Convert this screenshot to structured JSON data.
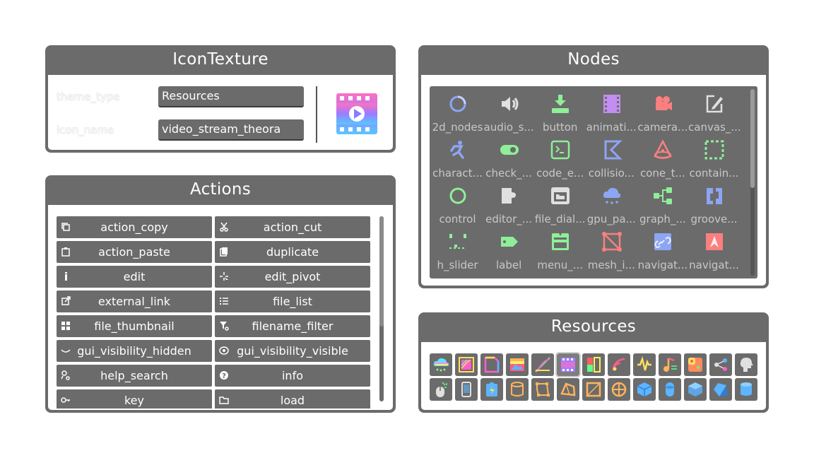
{
  "icontexture": {
    "title": "IconTexture",
    "theme_type_label": "theme_type",
    "theme_type_value": "Resources",
    "icon_name_label": "icon_name",
    "icon_name_value": "video_stream_theora"
  },
  "actions": {
    "title": "Actions",
    "items": [
      {
        "label": "action_copy",
        "icon": "copy-icon"
      },
      {
        "label": "action_cut",
        "icon": "scissors-icon"
      },
      {
        "label": "action_paste",
        "icon": "paste-icon"
      },
      {
        "label": "duplicate",
        "icon": "duplicate-icon"
      },
      {
        "label": "edit",
        "icon": "pencil-icon"
      },
      {
        "label": "edit_pivot",
        "icon": "pivot-icon"
      },
      {
        "label": "external_link",
        "icon": "external-link-icon"
      },
      {
        "label": "file_list",
        "icon": "list-icon"
      },
      {
        "label": "file_thumbnail",
        "icon": "thumbnail-grid-icon"
      },
      {
        "label": "filename_filter",
        "icon": "filter-icon"
      },
      {
        "label": "gui_visibility_hidden",
        "icon": "eye-closed-icon"
      },
      {
        "label": "gui_visibility_visible",
        "icon": "eye-open-icon"
      },
      {
        "label": "help_search",
        "icon": "help-search-icon"
      },
      {
        "label": "info",
        "icon": "info-icon"
      },
      {
        "label": "key",
        "icon": "key-icon"
      },
      {
        "label": "load",
        "icon": "folder-icon"
      }
    ]
  },
  "nodes": {
    "title": "Nodes",
    "items": [
      {
        "label": "2d_nodes",
        "icon": "ring-icon",
        "color": "#8da5f3"
      },
      {
        "label": "audio_s...",
        "icon": "speaker-icon",
        "color": "#e0e0e0"
      },
      {
        "label": "button",
        "icon": "download-button-icon",
        "color": "#8eef97"
      },
      {
        "label": "animati...",
        "icon": "film-icon",
        "color": "#c38ef1"
      },
      {
        "label": "camera...",
        "icon": "camera-icon",
        "color": "#fc7f7f"
      },
      {
        "label": "canvas_...",
        "icon": "canvas-edit-icon",
        "color": "#e0e0e0"
      },
      {
        "label": "charact...",
        "icon": "character-icon",
        "color": "#8da5f3"
      },
      {
        "label": "check_...",
        "icon": "toggle-icon",
        "color": "#8eef97"
      },
      {
        "label": "code_e...",
        "icon": "terminal-icon",
        "color": "#8eef97"
      },
      {
        "label": "collisio...",
        "icon": "collision-icon",
        "color": "#8da5f3"
      },
      {
        "label": "cone_t...",
        "icon": "cone-icon",
        "color": "#fc7f7f"
      },
      {
        "label": "contain...",
        "icon": "container-icon",
        "color": "#8eef97"
      },
      {
        "label": "control",
        "icon": "control-ring-icon",
        "color": "#8eef97"
      },
      {
        "label": "editor_...",
        "icon": "plugin-icon",
        "color": "#e0e0e0"
      },
      {
        "label": "file_dial...",
        "icon": "file-dialog-icon",
        "color": "#e0e0e0"
      },
      {
        "label": "gpu_pa...",
        "icon": "cloud-particles-icon",
        "color": "#8da5f3"
      },
      {
        "label": "graph_...",
        "icon": "graph-icon",
        "color": "#8eef97"
      },
      {
        "label": "groove...",
        "icon": "groove-joint-icon",
        "color": "#8da5f3"
      },
      {
        "label": "h_slider",
        "icon": "slider-icon",
        "color": "#8eef97"
      },
      {
        "label": "label",
        "icon": "tag-icon",
        "color": "#8eef97"
      },
      {
        "label": "menu_...",
        "icon": "menu-bar-icon",
        "color": "#8eef97"
      },
      {
        "label": "mesh_i...",
        "icon": "mesh-icon",
        "color": "#fc7f7f"
      },
      {
        "label": "navigat...",
        "icon": "navigation-link-icon",
        "color": "#8da5f3"
      },
      {
        "label": "navigat...",
        "icon": "navigation-region-icon",
        "color": "#fc7f7f"
      }
    ]
  },
  "resources": {
    "title": "Resources",
    "items": [
      {
        "icon": "rainbow-cloud-icon",
        "selected": false
      },
      {
        "icon": "gradient-texture-icon",
        "selected": false
      },
      {
        "icon": "rainbow-page-icon",
        "selected": false
      },
      {
        "icon": "rainbow-image-icon",
        "selected": false
      },
      {
        "icon": "curve-texture-icon",
        "selected": false
      },
      {
        "icon": "video-stream-theora-icon",
        "selected": true
      },
      {
        "icon": "color-ramp-icon",
        "selected": false
      },
      {
        "icon": "audio-stream-icon",
        "selected": false
      },
      {
        "icon": "waveform-icon",
        "selected": false
      },
      {
        "icon": "music-note-icon",
        "selected": false
      },
      {
        "icon": "dice-texture-icon",
        "selected": false
      },
      {
        "icon": "shader-nodes-icon",
        "selected": false
      },
      {
        "icon": "head-profile-icon",
        "selected": false
      },
      {
        "icon": "mouse-click-icon",
        "selected": false
      },
      {
        "icon": "phone-icon",
        "selected": false
      },
      {
        "icon": "battery-icon",
        "selected": false
      },
      {
        "icon": "cylinder-shape-icon",
        "selected": false
      },
      {
        "icon": "polygon-2d-icon",
        "selected": false
      },
      {
        "icon": "convex-polygon-icon",
        "selected": false
      },
      {
        "icon": "rectangle-shape-icon",
        "selected": false
      },
      {
        "icon": "circle-target-icon",
        "selected": false
      },
      {
        "icon": "box-mesh-icon",
        "selected": false
      },
      {
        "icon": "capsule-mesh-icon",
        "selected": false
      },
      {
        "icon": "cube-3d-icon",
        "selected": false
      },
      {
        "icon": "prism-mesh-icon",
        "selected": false
      },
      {
        "icon": "cylinder-mesh-icon",
        "selected": false
      }
    ]
  }
}
